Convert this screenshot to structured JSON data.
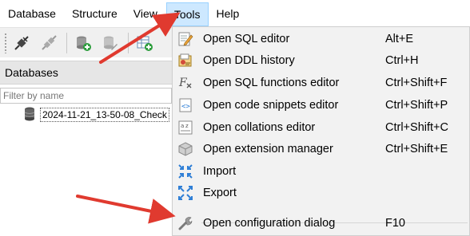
{
  "menubar": {
    "items": [
      {
        "label": "Database"
      },
      {
        "label": "Structure"
      },
      {
        "label": "View"
      },
      {
        "label": "Tools"
      },
      {
        "label": "Help"
      }
    ],
    "active": "Tools"
  },
  "toolbar": {
    "icons": [
      "connect-icon",
      "disconnect-icon",
      "add-database-icon",
      "edit-database-icon",
      "add-table-icon"
    ]
  },
  "panel": {
    "title": "Databases",
    "filter_placeholder": "Filter by name",
    "tree_items": [
      {
        "label": "2024-11-21_13-50-08_Check"
      }
    ]
  },
  "tools_menu": {
    "items": [
      {
        "label": "Open SQL editor",
        "shortcut": "Alt+E",
        "icon": "sql-editor-icon"
      },
      {
        "label": "Open DDL history",
        "shortcut": "Ctrl+H",
        "icon": "ddl-history-icon"
      },
      {
        "label": "Open SQL functions editor",
        "shortcut": "Ctrl+Shift+F",
        "icon": "sql-functions-icon"
      },
      {
        "label": "Open code snippets editor",
        "shortcut": "Ctrl+Shift+P",
        "icon": "code-snippets-icon"
      },
      {
        "label": "Open collations editor",
        "shortcut": "Ctrl+Shift+C",
        "icon": "collations-icon"
      },
      {
        "label": "Open extension manager",
        "shortcut": "Ctrl+Shift+E",
        "icon": "extension-manager-icon"
      },
      {
        "label": "Import",
        "shortcut": "",
        "icon": "import-icon"
      },
      {
        "label": "Export",
        "shortcut": "",
        "icon": "export-icon"
      },
      {
        "label": "Open configuration dialog",
        "shortcut": "F10",
        "icon": "wrench-icon"
      }
    ]
  },
  "colors": {
    "menu_active_bg": "#cde8ff",
    "menu_bg": "#f2f2f2",
    "arrow": "#e03a2f",
    "icon_blue": "#2f7fd6"
  }
}
